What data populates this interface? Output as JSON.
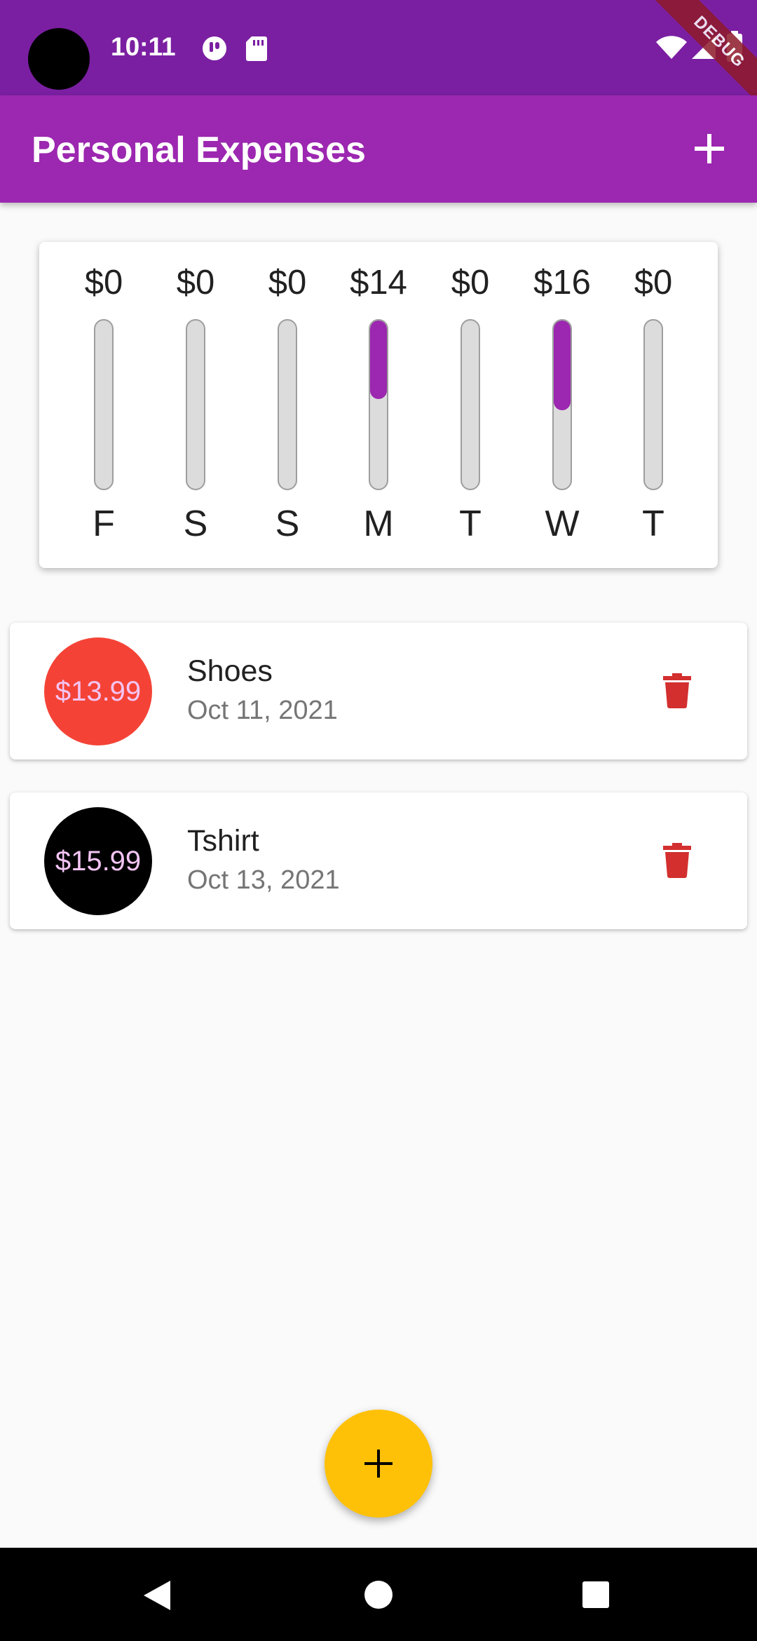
{
  "status_bar": {
    "time": "10:11",
    "icons": [
      "camera-hole-icon",
      "notification-app-icon",
      "sd-card-icon",
      "wifi-icon",
      "cell-signal-icon",
      "battery-icon"
    ],
    "debug_banner": "DEBUG"
  },
  "app_bar": {
    "title": "Personal Expenses",
    "add_icon": "plus-icon"
  },
  "chart_data": {
    "type": "bar",
    "categories": [
      "F",
      "S",
      "S",
      "M",
      "T",
      "W",
      "T"
    ],
    "labels": [
      "$0",
      "$0",
      "$0",
      "$14",
      "$0",
      "$16",
      "$0"
    ],
    "fractions": [
      0,
      0,
      0,
      0.4666,
      0,
      0.5333,
      0
    ],
    "bar_color": "#9c27b0",
    "track_color": "#dcdcdc"
  },
  "transactions": [
    {
      "amount": "$13.99",
      "title": "Shoes",
      "date": "Oct 11, 2021",
      "avatar_color": "#f44336",
      "delete_icon": "trash-icon"
    },
    {
      "amount": "$15.99",
      "title": "Tshirt",
      "date": "Oct 13, 2021",
      "avatar_color": "#000000",
      "delete_icon": "trash-icon"
    }
  ],
  "fab": {
    "icon": "plus-icon",
    "color": "#ffc107"
  },
  "nav_bar": {
    "buttons": [
      "back-icon",
      "home-icon",
      "recents-icon"
    ]
  },
  "colors": {
    "primary": "#9c27b0",
    "primary_dark": "#7b1fa2",
    "delete": "#d32f2f",
    "accent": "#ffc107"
  }
}
